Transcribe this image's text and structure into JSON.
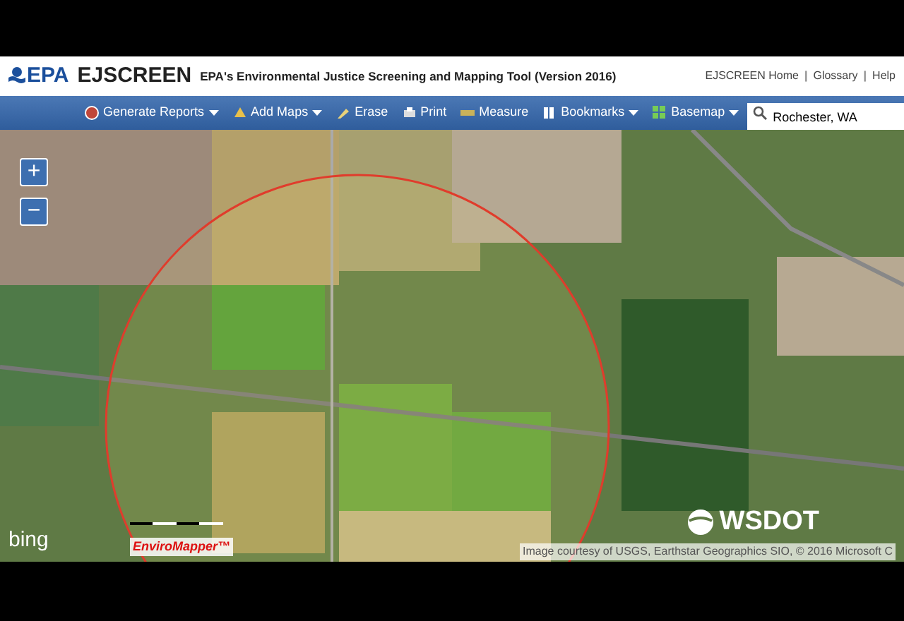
{
  "header": {
    "logo": "EPA",
    "app_name": "EJSCREEN",
    "subtitle": "EPA's Environmental Justice Screening and Mapping Tool (Version 2016)",
    "links": [
      {
        "label": "EJSCREEN Home",
        "kind": "link"
      },
      {
        "label": "|",
        "kind": "separator"
      },
      {
        "label": "Glossary",
        "kind": "link"
      },
      {
        "label": "|",
        "kind": "separator"
      },
      {
        "label": "Help",
        "kind": "link"
      }
    ]
  },
  "toolbar": [
    {
      "label": "Generate Reports",
      "kind": "menu"
    },
    {
      "label": "Add Maps",
      "kind": "menu"
    },
    {
      "label": "Erase",
      "kind": "button"
    },
    {
      "label": "Print",
      "kind": "button"
    },
    {
      "label": "Measure",
      "kind": "button"
    },
    {
      "label": "Bookmarks",
      "kind": "menu"
    },
    {
      "label": "Basemap",
      "kind": "menu"
    }
  ],
  "search": {
    "value": "Rochester, WA"
  },
  "map": {
    "zoom_in": "+",
    "zoom_out": "−",
    "provider": "bing",
    "tool_logo": "EnviroMapper™",
    "agency_logo": "WSDOT",
    "attribution": "Image courtesy of USGS, Earthstar Geographics SIO, © 2016 Microsoft C"
  }
}
